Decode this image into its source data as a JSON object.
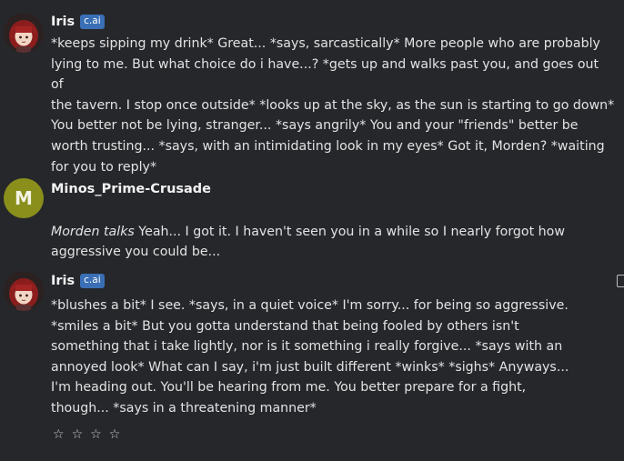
{
  "messages": [
    {
      "author": "Iris",
      "badge": "c.ai",
      "text": "*keeps sipping my drink*  Great... *says, sarcastically*  More people who are probably\nlying to me. But what choice do i have...? *gets up and walks past you, and goes out of\nthe tavern. I stop once outside*  *looks up at the sky, as the sun is starting to go down*\nYou better not be lying, stranger... *says angrily*  You and your \"friends\" better be\nworth trusting... *says, with an intimidating look in my eyes*  Got it, Morden? *waiting\nfor you to reply*"
    },
    {
      "author": "Minos_Prime-Crusade",
      "avatar_letter": "M",
      "italic_prefix": "Morden talks",
      "text": " Yeah... I got it. I haven't seen you in a while so I nearly forgot how\naggressive you could be..."
    },
    {
      "author": "Iris",
      "badge": "c.ai",
      "text": "*blushes a bit*  I see. *says, in a quiet voice*  I'm sorry... for being so aggressive.\n*smiles a bit*  But you gotta understand that being fooled by others isn't\nsomething that i take lightly, nor is it something i really forgive... *says with an\nannoyed look*  What can I say, i'm just built different *winks*  *sighs*  Anyways...\nI'm heading out. You'll be hearing from me. You better prepare for a fight,\nthough... *says in a threatening manner*"
    }
  ],
  "rating": {
    "stars": [
      "☆",
      "☆",
      "☆",
      "☆"
    ]
  },
  "colors": {
    "background": "#26272b",
    "badge": "#3a6fb5",
    "avatar_m": "#8a8f1c"
  }
}
